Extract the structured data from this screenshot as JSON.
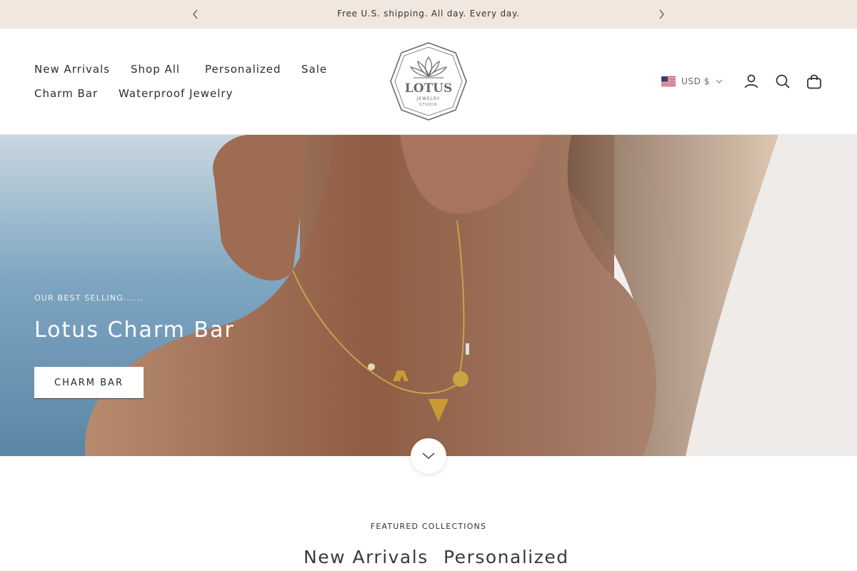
{
  "announcement": {
    "text": "Free U.S. shipping. All day. Every day."
  },
  "nav": {
    "items": [
      {
        "label": "New Arrivals"
      },
      {
        "label": "Shop All"
      },
      {
        "label": "Personalized"
      },
      {
        "label": "Sale"
      },
      {
        "label": "Charm Bar"
      },
      {
        "label": "Waterproof Jewelry"
      }
    ]
  },
  "logo": {
    "name": "LOTUS",
    "line1": "JEWELRY",
    "line2": "STUDIO"
  },
  "currency": {
    "label": "USD $",
    "flag_icon": "us-flag-icon"
  },
  "header_icons": [
    "account-icon",
    "search-icon",
    "cart-icon"
  ],
  "hero": {
    "kicker": "OUR BEST SELLING......",
    "title": "Lotus Charm Bar",
    "button": "CHARM BAR"
  },
  "featured": {
    "kicker": "FEATURED COLLECTIONS",
    "tabs": [
      {
        "label": "New Arrivals"
      },
      {
        "label": "Personalized"
      }
    ]
  },
  "colors": {
    "announce_bg": "#f1e7df",
    "accent": "#2a2a2a",
    "logo_stroke": "#6b6b6b"
  }
}
